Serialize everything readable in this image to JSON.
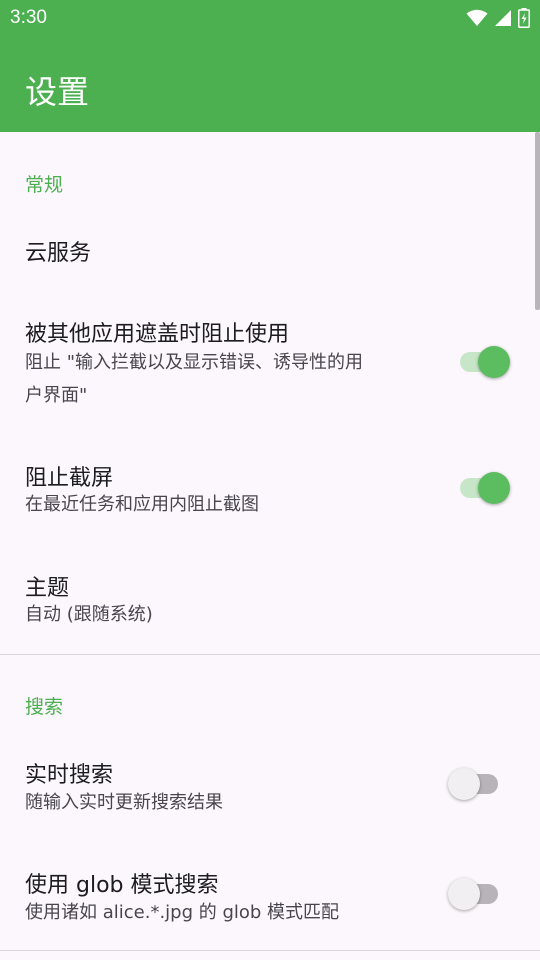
{
  "status_bar": {
    "time": "3:30"
  },
  "app_bar": {
    "title": "设置"
  },
  "sections": {
    "general": {
      "title": "常规",
      "cloud": {
        "title": "云服务"
      },
      "overlay": {
        "title": "被其他应用遮盖时阻止使用",
        "summary_line1": "阻止 \"输入拦截以及显示错误、诱导性的用",
        "summary_line2": "户界面\"",
        "enabled": true
      },
      "screenshot": {
        "title": "阻止截屏",
        "summary": "在最近任务和应用内阻止截图",
        "enabled": true
      },
      "theme": {
        "title": "主题",
        "summary": "自动 (跟随系统)"
      }
    },
    "search": {
      "title": "搜索",
      "live": {
        "title": "实时搜索",
        "summary": "随输入实时更新搜索结果",
        "enabled": false
      },
      "glob": {
        "title": "使用 glob 模式搜索",
        "summary": "使用诸如 alice.*.jpg 的 glob 模式匹配",
        "enabled": false
      }
    }
  },
  "colors": {
    "accent": "#4caf50",
    "background": "#fcf7fc"
  }
}
